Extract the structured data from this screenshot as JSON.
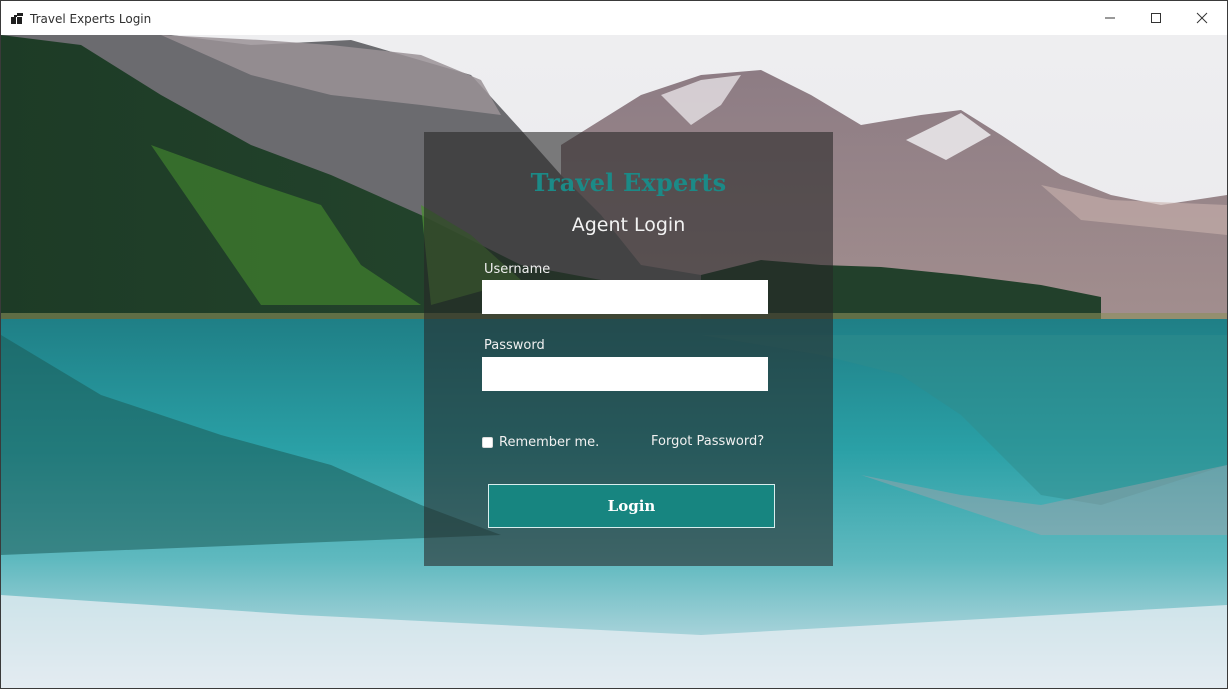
{
  "window": {
    "title": "Travel Experts Login",
    "controls": {
      "minimize": "minimize-icon",
      "maximize": "maximize-icon",
      "close": "close-icon"
    }
  },
  "login": {
    "brand": "Travel Experts",
    "subtitle": "Agent Login",
    "username_label": "Username",
    "username_value": "",
    "password_label": "Password",
    "password_value": "",
    "remember_label": "Remember me.",
    "remember_checked": false,
    "forgot_link": "Forgot Password?",
    "submit_label": "Login"
  },
  "colors": {
    "brand": "#1b8a87",
    "button": "#178580",
    "panel_overlay": "rgba(38,38,38,0.58)"
  }
}
